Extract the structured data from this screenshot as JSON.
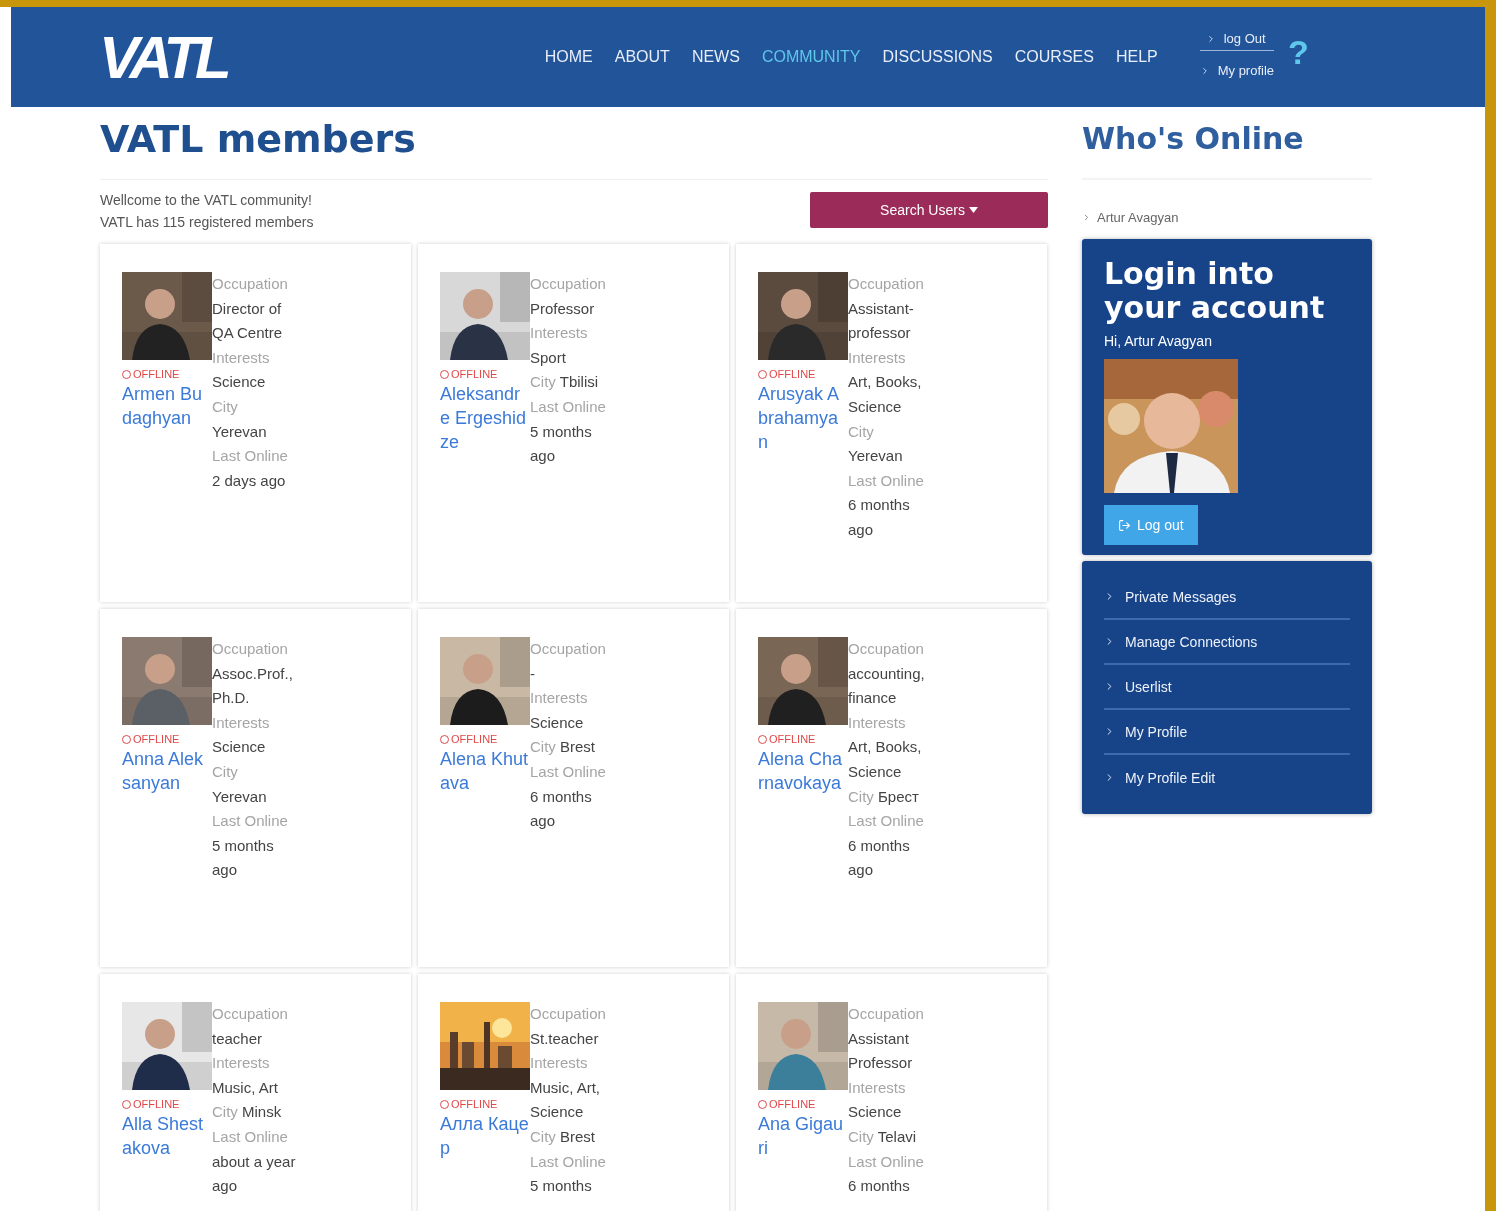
{
  "header": {
    "logo": "VATL",
    "nav": [
      {
        "label": "HOME",
        "selected": false
      },
      {
        "label": "ABOUT",
        "selected": false
      },
      {
        "label": "NEWS",
        "selected": false
      },
      {
        "label": "COMMUNITY",
        "selected": true
      },
      {
        "label": "DISCUSSIONS",
        "selected": false
      },
      {
        "label": "COURSES",
        "selected": false
      },
      {
        "label": "HELP",
        "selected": false
      }
    ],
    "user_links": [
      "log Out",
      "My profile"
    ],
    "help": "?"
  },
  "main": {
    "title": "VATL members",
    "welcome": "Wellcome to the VATL community!",
    "count": "VATL has 115 registered members",
    "search_button": "Search Users",
    "members": [
      {
        "name": "Armen Budaghyan",
        "status": "OFFLINE",
        "online": false,
        "details": [
          {
            "kind": "label",
            "text": "Occupation"
          },
          {
            "kind": "value",
            "text": "Director of QA Centre"
          },
          {
            "kind": "label",
            "text": "Interests"
          },
          {
            "kind": "value",
            "text": "Science"
          },
          {
            "kind": "label",
            "text": "City"
          },
          {
            "kind": "value",
            "text": "Yerevan"
          },
          {
            "kind": "label",
            "text": "Last Online"
          },
          {
            "kind": "value",
            "text": "2 days ago"
          }
        ]
      },
      {
        "name": "Aleksandre Ergeshidze",
        "status": "OFFLINE",
        "online": false,
        "details": [
          {
            "kind": "label",
            "text": "Occupation"
          },
          {
            "kind": "value",
            "text": "Professor"
          },
          {
            "kind": "label",
            "text": "Interests"
          },
          {
            "kind": "value",
            "text": "Sport"
          },
          {
            "kind": "inline",
            "label": "City",
            "text": "Tbilisi"
          },
          {
            "kind": "label",
            "text": "Last Online"
          },
          {
            "kind": "value",
            "text": "5 months ago"
          }
        ]
      },
      {
        "name": "Arusyak Abrahamyan",
        "status": "OFFLINE",
        "online": false,
        "details": [
          {
            "kind": "label",
            "text": "Occupation"
          },
          {
            "kind": "value",
            "text": "Assistant-professor"
          },
          {
            "kind": "label",
            "text": "Interests"
          },
          {
            "kind": "value",
            "text": "Art, Books, Science"
          },
          {
            "kind": "label",
            "text": "City"
          },
          {
            "kind": "value",
            "text": "Yerevan"
          },
          {
            "kind": "label",
            "text": "Last Online"
          },
          {
            "kind": "value",
            "text": "6 months ago"
          }
        ]
      },
      {
        "name": "Anna Aleksanyan",
        "status": "OFFLINE",
        "online": false,
        "details": [
          {
            "kind": "label",
            "text": "Occupation"
          },
          {
            "kind": "value",
            "text": "Assoc.Prof., Ph.D."
          },
          {
            "kind": "label",
            "text": "Interests"
          },
          {
            "kind": "value",
            "text": "Science"
          },
          {
            "kind": "label",
            "text": "City"
          },
          {
            "kind": "value",
            "text": "Yerevan"
          },
          {
            "kind": "label",
            "text": "Last Online"
          },
          {
            "kind": "value",
            "text": "5 months ago"
          }
        ]
      },
      {
        "name": "Alena Khutava",
        "status": "OFFLINE",
        "online": false,
        "details": [
          {
            "kind": "label",
            "text": "Occupation"
          },
          {
            "kind": "value",
            "text": "-"
          },
          {
            "kind": "label",
            "text": "Interests"
          },
          {
            "kind": "value",
            "text": "Science"
          },
          {
            "kind": "inline",
            "label": "City",
            "text": "Brest"
          },
          {
            "kind": "label",
            "text": "Last Online"
          },
          {
            "kind": "value",
            "text": "6 months ago"
          }
        ]
      },
      {
        "name": "Alena Charnavokaya",
        "status": "OFFLINE",
        "online": false,
        "details": [
          {
            "kind": "label",
            "text": "Occupation"
          },
          {
            "kind": "value",
            "text": "accounting, finance"
          },
          {
            "kind": "label",
            "text": "Interests"
          },
          {
            "kind": "value",
            "text": "Art, Books, Science"
          },
          {
            "kind": "inline",
            "label": "City",
            "text": "Брест"
          },
          {
            "kind": "label",
            "text": "Last Online"
          },
          {
            "kind": "value",
            "text": "6 months ago"
          }
        ]
      },
      {
        "name": "Alla Shestakova",
        "status": "OFFLINE",
        "online": false,
        "details": [
          {
            "kind": "label",
            "text": "Occupation"
          },
          {
            "kind": "value",
            "text": "teacher"
          },
          {
            "kind": "label",
            "text": "Interests"
          },
          {
            "kind": "value",
            "text": "Music, Art"
          },
          {
            "kind": "inline",
            "label": "City",
            "text": "Minsk"
          },
          {
            "kind": "label",
            "text": "Last Online"
          },
          {
            "kind": "value",
            "text": "about a year ago"
          }
        ]
      },
      {
        "name": "Алла Кацер",
        "status": "OFFLINE",
        "online": false,
        "details": [
          {
            "kind": "label",
            "text": "Occupation"
          },
          {
            "kind": "value",
            "text": "St.teacher"
          },
          {
            "kind": "label",
            "text": "Interests"
          },
          {
            "kind": "value",
            "text": "Music, Art, Science"
          },
          {
            "kind": "inline",
            "label": "City",
            "text": "Brest"
          },
          {
            "kind": "label",
            "text": "Last Online"
          },
          {
            "kind": "value",
            "text": "5 months"
          }
        ]
      },
      {
        "name": "Ana Gigauri",
        "status": "OFFLINE",
        "online": false,
        "details": [
          {
            "kind": "label",
            "text": "Occupation"
          },
          {
            "kind": "value",
            "text": "Assistant Professor"
          },
          {
            "kind": "label",
            "text": "Interests"
          },
          {
            "kind": "value",
            "text": "Science"
          },
          {
            "kind": "inline",
            "label": "City",
            "text": "Telavi"
          },
          {
            "kind": "label",
            "text": "Last Online"
          },
          {
            "kind": "value",
            "text": "6 months"
          }
        ]
      }
    ]
  },
  "sidebar": {
    "title": "Who's Online",
    "online_users": [
      "Artur Avagyan"
    ],
    "login_panel": {
      "title": "Login into your account",
      "greeting": "Hi, Artur Avagyan",
      "logout_button": "Log out"
    },
    "menu": [
      "Private Messages",
      "Manage Connections",
      "Userlist",
      "My Profile",
      "My Profile Edit"
    ]
  }
}
